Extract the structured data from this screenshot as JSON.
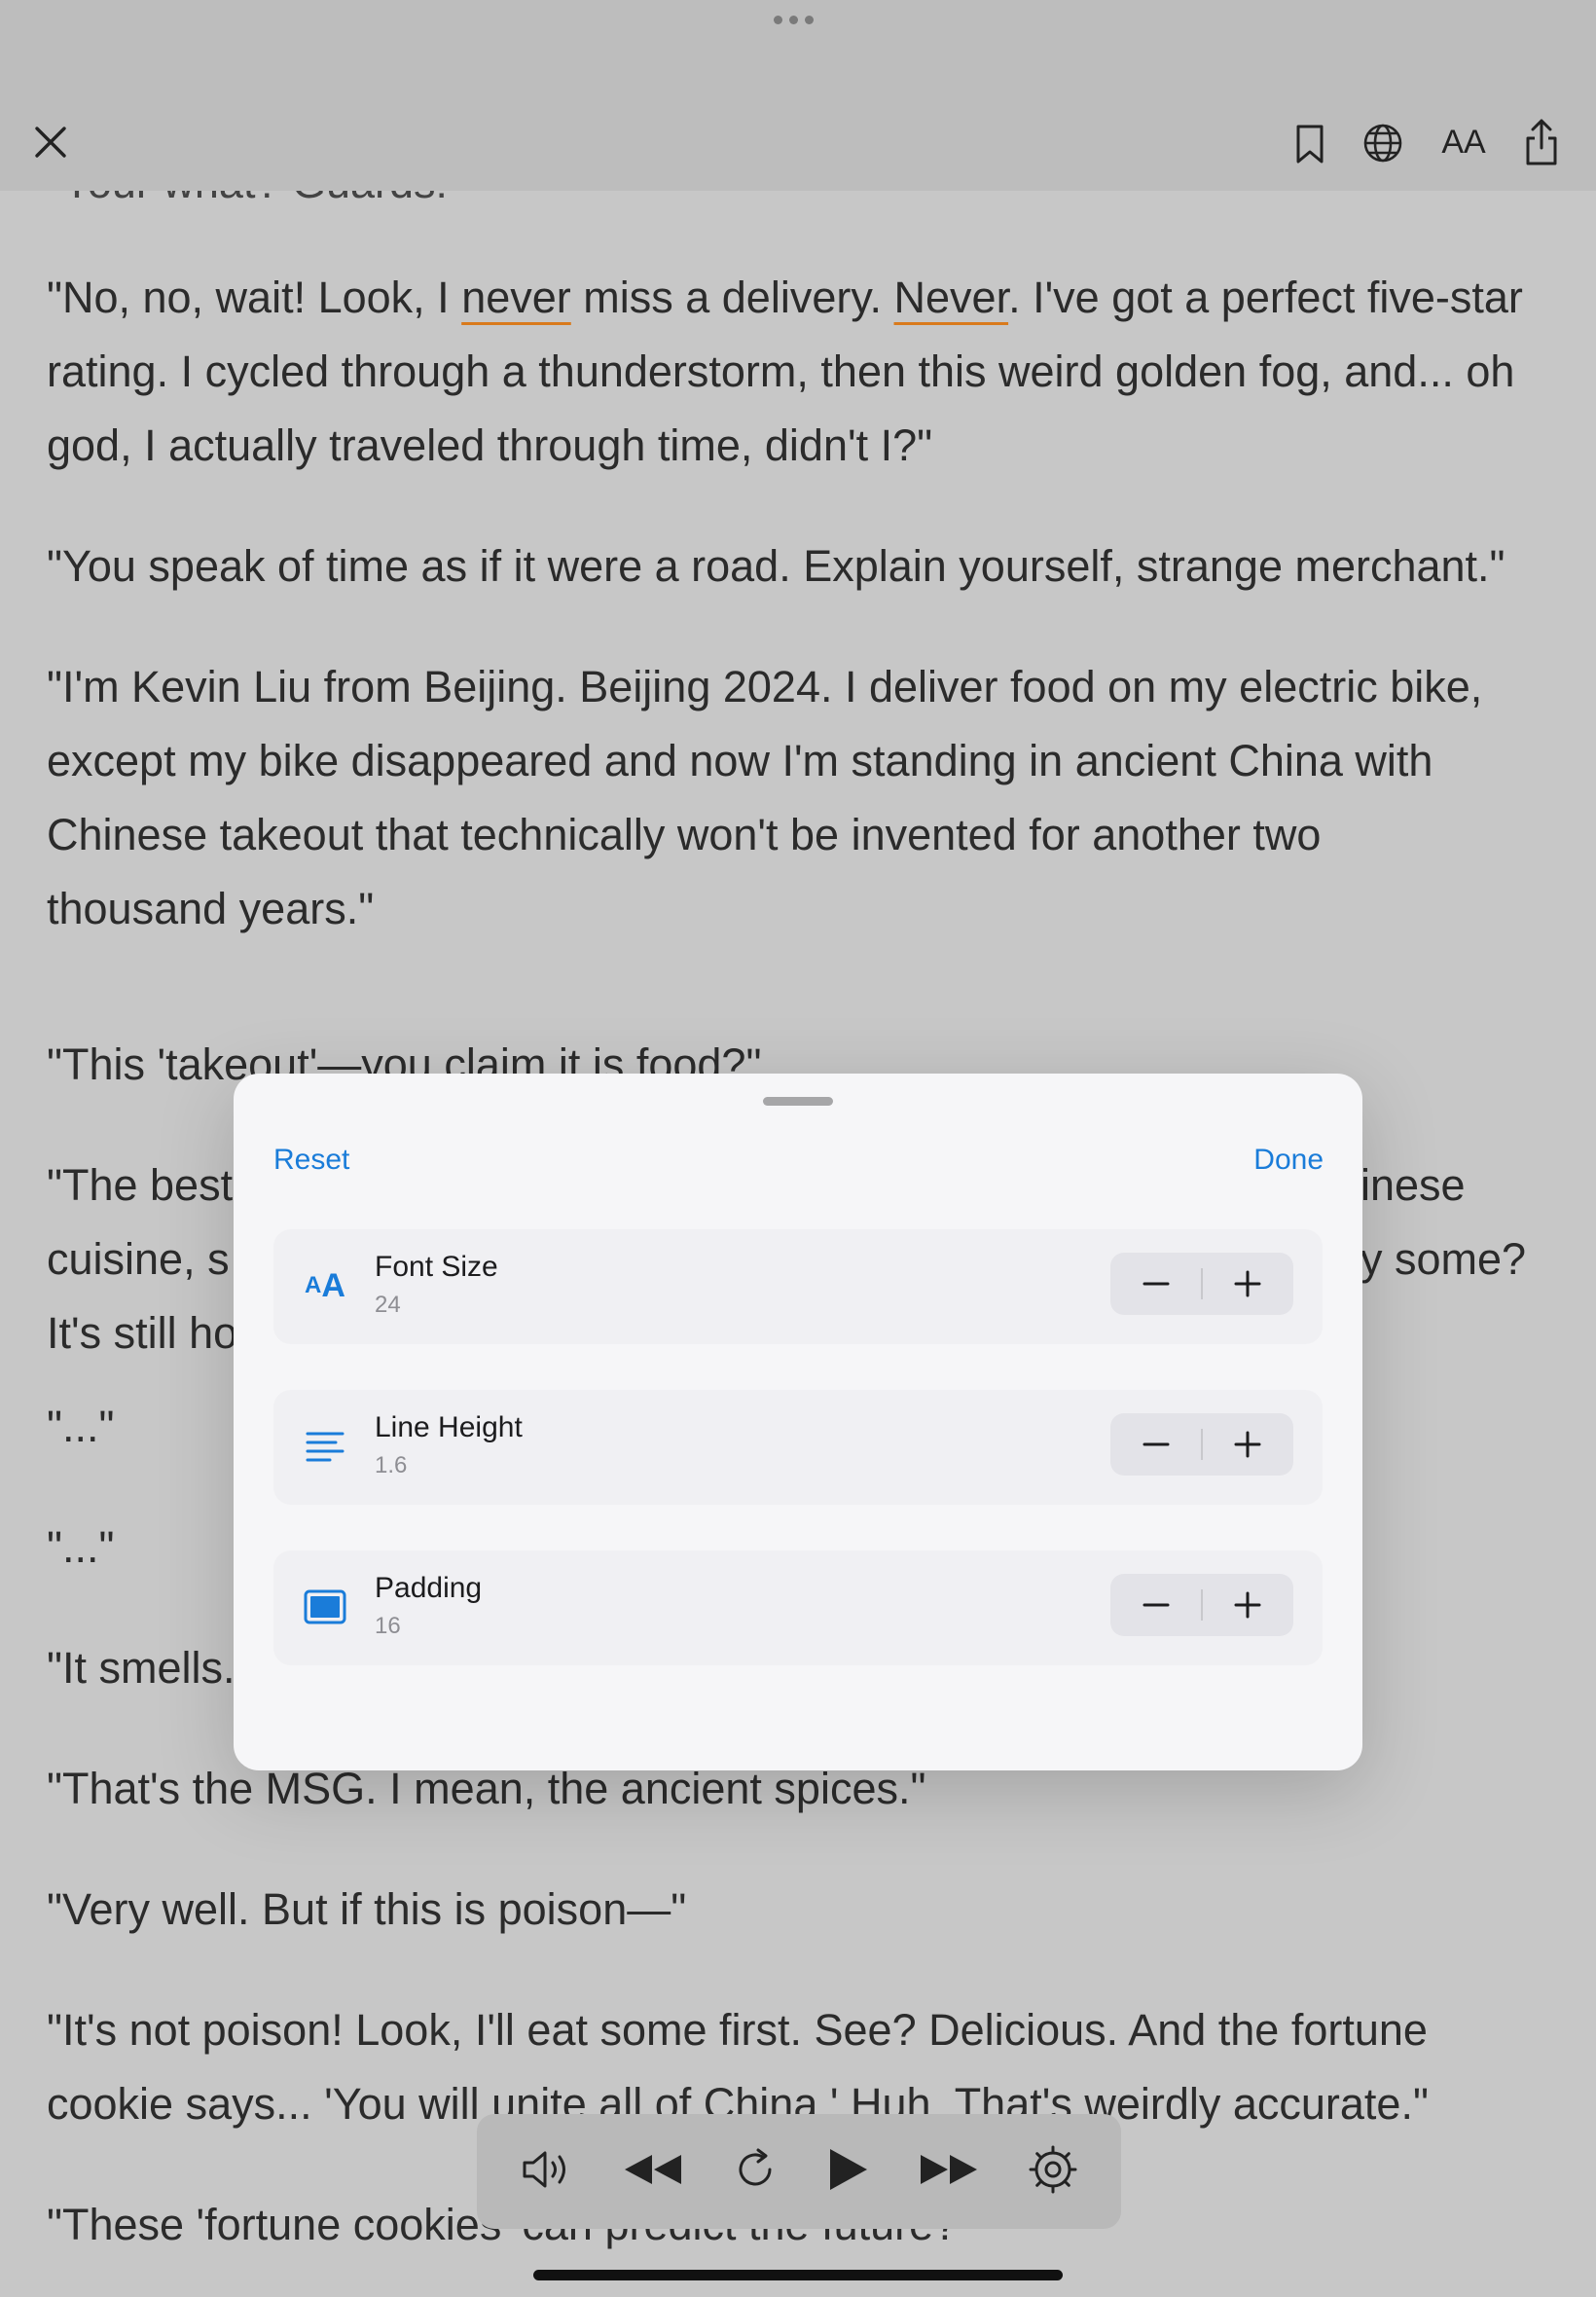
{
  "toolbar": {
    "close_icon": "close-icon",
    "bookmark_icon": "bookmark-icon",
    "translate_icon": "globe-icon",
    "text_size_label": "AA",
    "share_icon": "share-icon"
  },
  "reader": {
    "top_fragment": "\"Your what? Guards!\"",
    "paragraphs": [
      {
        "lines": [
          "\"No, no, wait! Look, I never miss a delivery. Never. I've got a perfect five-star",
          "rating. I cycled through a thunderstorm, then this weird golden fog, and... oh",
          "god, I actually traveled through time, didn't I?\""
        ]
      },
      {
        "lines": [
          "\"You speak of time as if it were a road. Explain yourself, strange merchant.\""
        ]
      },
      {
        "lines": [
          "\"I'm Kevin Liu from Beijing. Beijing 2024. I deliver food on my electric bike,",
          "except my bike disappeared and now I'm standing in ancient China with",
          "Chinese takeout that technically won't be invented for another two",
          "thousand years.\""
        ]
      },
      {
        "lines": [
          "\"This 'takeout'—you claim it is food?\""
        ]
      },
      {
        "lines": [
          "\"The best",
          "cuisine, s",
          "It's still ho"
        ],
        "right": [
          "inese",
          "y some?"
        ]
      },
      {
        "lines": [
          "\"...\""
        ]
      },
      {
        "lines": [
          "\"...\""
        ]
      },
      {
        "lines": [
          "\"It smells."
        ]
      },
      {
        "lines": [
          "\"That's the MSG. I mean, the ancient spices.\""
        ]
      },
      {
        "lines": [
          "\"Very well. But if this is poison—\""
        ]
      },
      {
        "lines": [
          "\"It's not poison! Look, I'll eat some first. See? Delicious. And the fortune",
          "cookie says... 'You will unite all of China.' Huh. That's weirdly accurate.\""
        ]
      },
      {
        "lines": [
          "\"These 'fortune cookies' can predict the future?\""
        ]
      }
    ]
  },
  "settings_sheet": {
    "reset_label": "Reset",
    "done_label": "Done",
    "rows": [
      {
        "label": "Font Size",
        "value": "24",
        "icon": "text-size-icon"
      },
      {
        "label": "Line Height",
        "value": "1.6",
        "icon": "line-height-icon"
      },
      {
        "label": "Padding",
        "value": "16",
        "icon": "padding-icon"
      }
    ],
    "decrement_symbol": "−",
    "increment_symbol": "+"
  },
  "player": {
    "controls": [
      "speaker-icon",
      "rewind-icon",
      "replay-icon",
      "play-icon",
      "fast-forward-icon",
      "settings-gear-icon"
    ]
  },
  "colors": {
    "accent": "#1a7cd9",
    "highlight_underline": "#d97a1c",
    "dim_overlay": "#c7c7c7"
  }
}
